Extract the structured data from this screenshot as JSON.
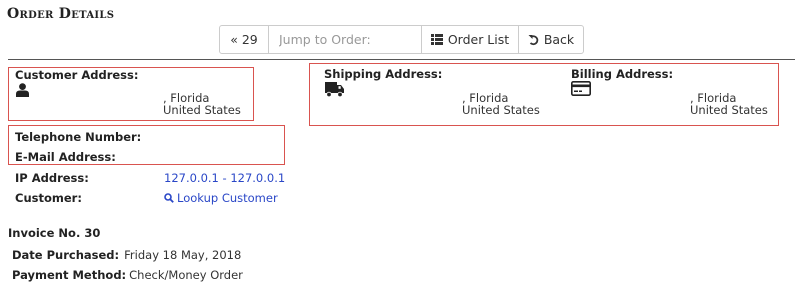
{
  "page": {
    "title": "Order Details"
  },
  "toolbar": {
    "prev_label": "« 29",
    "jump_placeholder": "Jump to Order:",
    "order_list_label": "Order List",
    "back_label": "Back"
  },
  "customer_address": {
    "label": "Customer Address:",
    "city_state": ", Florida",
    "country": "United States"
  },
  "shipping_address": {
    "label": "Shipping Address:",
    "city_state": ", Florida",
    "country": "United States"
  },
  "billing_address": {
    "label": "Billing Address:",
    "city_state": ", Florida",
    "country": "United States"
  },
  "contact": {
    "telephone_label": "Telephone Number:",
    "email_label": "E-Mail Address:"
  },
  "ip": {
    "label": "IP Address:",
    "value": "127.0.0.1 - 127.0.0.1"
  },
  "customer": {
    "label": "Customer:",
    "lookup_label": "Lookup Customer"
  },
  "invoice": {
    "label": "Invoice No. 30"
  },
  "date_purchased": {
    "label": "Date Purchased:",
    "value": "Friday 18 May, 2018"
  },
  "payment_method": {
    "label": "Payment Method:",
    "value": "Check/Money Order"
  },
  "colors": {
    "highlight_border": "#d9534f",
    "link": "#2a47c7"
  },
  "icons": {
    "customer": "user-icon",
    "shipping": "truck-icon",
    "billing": "credit-card-icon",
    "order_list": "list-icon",
    "back": "undo-icon",
    "lookup": "search-icon"
  }
}
